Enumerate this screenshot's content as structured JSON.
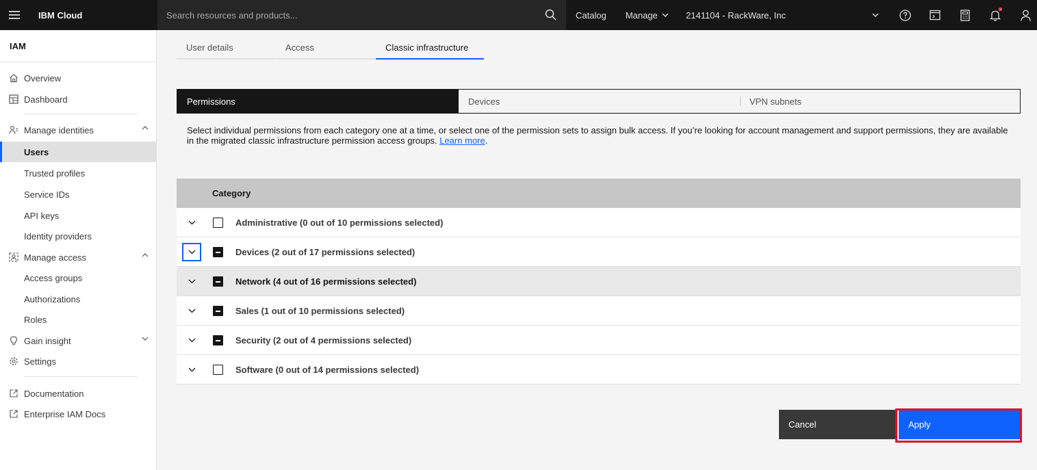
{
  "header": {
    "brand": "IBM Cloud",
    "search_placeholder": "Search resources and products...",
    "nav": [
      "Catalog",
      "Manage"
    ],
    "account": "2141104 - RackWare, Inc"
  },
  "sidebar": {
    "title": "IAM",
    "items": [
      {
        "label": "Overview"
      },
      {
        "label": "Dashboard"
      },
      {
        "label": "Manage identities"
      },
      {
        "label": "Users"
      },
      {
        "label": "Trusted profiles"
      },
      {
        "label": "Service IDs"
      },
      {
        "label": "API keys"
      },
      {
        "label": "Identity providers"
      },
      {
        "label": "Manage access"
      },
      {
        "label": "Access groups"
      },
      {
        "label": "Authorizations"
      },
      {
        "label": "Roles"
      },
      {
        "label": "Gain insight"
      },
      {
        "label": "Settings"
      },
      {
        "label": "Documentation"
      },
      {
        "label": "Enterprise IAM Docs"
      }
    ]
  },
  "tabs": [
    "User details",
    "Access",
    "Classic infrastructure"
  ],
  "switcher": [
    "Permissions",
    "Devices",
    "VPN subnets"
  ],
  "description": {
    "text": "Select individual permissions from each category one at a time, or select one of the permission sets to assign bulk access. If you’re looking for account management and support permissions, they are available in the migrated classic infrastructure permission access groups. ",
    "link": "Learn more",
    "end": "."
  },
  "table": {
    "header": "Category",
    "rows": [
      {
        "label": "Administrative (0 out of 10 permissions selected)"
      },
      {
        "label": "Devices (2 out of 17 permissions selected)"
      },
      {
        "label": "Network (4 out of 16 permissions selected)"
      },
      {
        "label": "Sales (1 out of 10 permissions selected)"
      },
      {
        "label": "Security (2 out of 4 permissions selected)"
      },
      {
        "label": "Software (0 out of 14 permissions selected)"
      }
    ]
  },
  "buttons": {
    "cancel": "Cancel",
    "apply": "Apply"
  },
  "colors": {
    "accent": "#0f62fe",
    "highlight": "#e0101f",
    "header_bg": "#161616"
  }
}
